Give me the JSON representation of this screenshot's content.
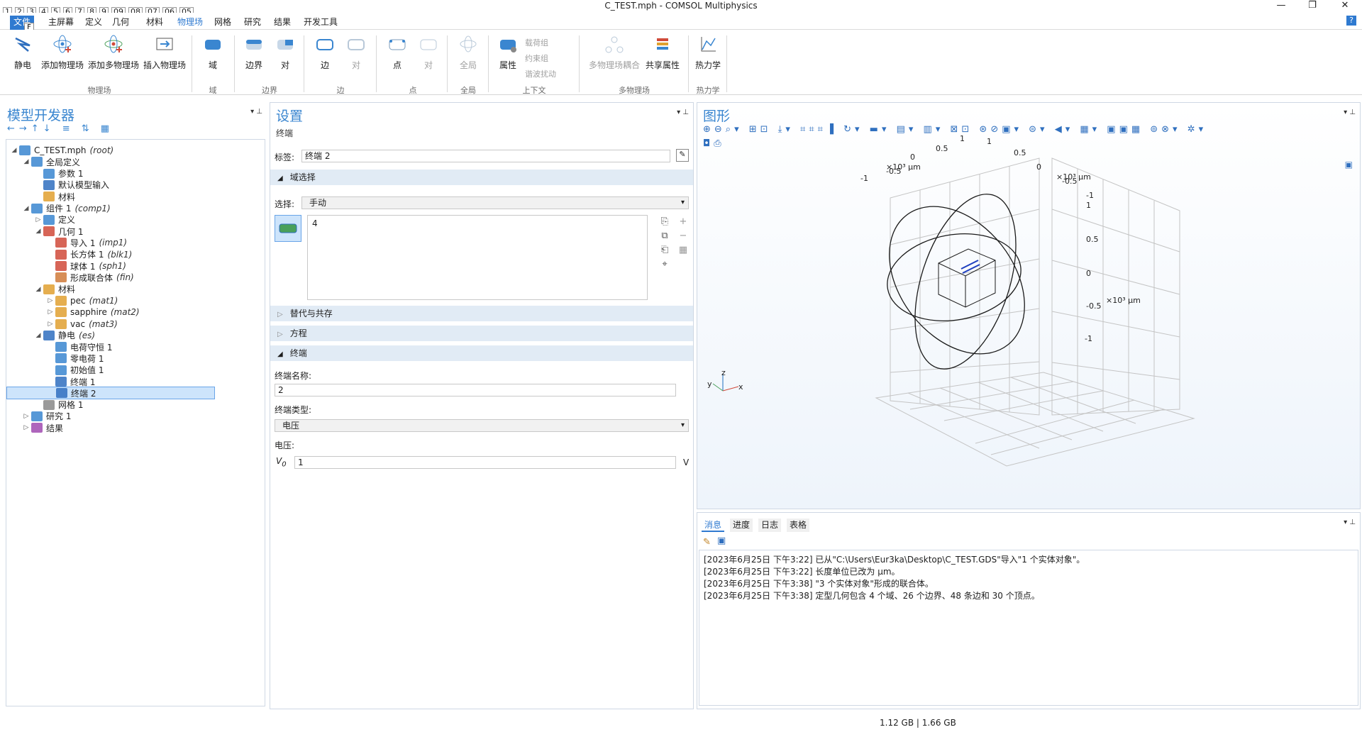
{
  "window": {
    "title": "C_TEST.mph - COMSOL Multiphysics",
    "min": "—",
    "max": "❐",
    "close": "✕"
  },
  "quick_access": {
    "keys": [
      "1",
      "2",
      "3",
      "4",
      "5",
      "6",
      "7",
      "8",
      "9",
      "09",
      "08",
      "07",
      "06",
      "05"
    ]
  },
  "menubar": {
    "file": "文件",
    "file_key": "F",
    "items": [
      "主屏幕",
      "定义",
      "几何",
      "材料",
      "物理场",
      "网格",
      "研究",
      "结果",
      "开发工具"
    ],
    "active": "物理场",
    "help": "?"
  },
  "ribbon": {
    "buttons": {
      "electrostatics": "静电",
      "add_physics": "添加物理场",
      "add_multiphysics": "添加多物理场",
      "insert_physics": "插入物理场",
      "domain": "域",
      "boundary": "边界",
      "pair": "对",
      "edge": "边",
      "edge_pair": "对",
      "point": "点",
      "point_pair": "对",
      "global": "全局",
      "attributes": "属性",
      "multiphysics_coupling": "多物理场耦合",
      "shared_properties": "共享属性",
      "thermodynamics": "热力学"
    },
    "small": {
      "load_group": "载荷组",
      "constraint_group": "约束组",
      "harmonic_perturbation": "谐波扰动"
    },
    "groups": {
      "physics": "物理场",
      "domain": "域",
      "boundary": "边界",
      "edge": "边",
      "point": "点",
      "global": "全局",
      "context": "上下文",
      "multiphysics": "多物理场",
      "thermo": "热力学"
    }
  },
  "model_builder": {
    "title": "模型开发器",
    "tree": [
      {
        "label": "C_TEST.mph",
        "tag": "(root)",
        "level": 0,
        "icon": "root-icon",
        "toggle": "◢"
      },
      {
        "label": "全局定义",
        "tag": "",
        "level": 1,
        "icon": "globe-icon",
        "toggle": "◢"
      },
      {
        "label": "参数 1",
        "tag": "",
        "level": 2,
        "icon": "parameters-icon",
        "toggle": ""
      },
      {
        "label": "默认模型输入",
        "tag": "",
        "level": 2,
        "icon": "model-input-icon",
        "toggle": ""
      },
      {
        "label": "材料",
        "tag": "",
        "level": 2,
        "icon": "materials-icon",
        "toggle": ""
      },
      {
        "label": "组件 1",
        "tag": "(comp1)",
        "level": 1,
        "icon": "component-icon",
        "toggle": "◢"
      },
      {
        "label": "定义",
        "tag": "",
        "level": 2,
        "icon": "definitions-icon",
        "toggle": "▷"
      },
      {
        "label": "几何 1",
        "tag": "",
        "level": 2,
        "icon": "geometry-icon",
        "toggle": "◢"
      },
      {
        "label": "导入 1",
        "tag": "(imp1)",
        "level": 3,
        "icon": "import-icon",
        "toggle": ""
      },
      {
        "label": "长方体 1",
        "tag": "(blk1)",
        "level": 3,
        "icon": "block-icon",
        "toggle": ""
      },
      {
        "label": "球体 1",
        "tag": "(sph1)",
        "level": 3,
        "icon": "sphere-icon",
        "toggle": ""
      },
      {
        "label": "形成联合体",
        "tag": "(fin)",
        "level": 3,
        "icon": "union-icon",
        "toggle": ""
      },
      {
        "label": "材料",
        "tag": "",
        "level": 2,
        "icon": "materials-icon",
        "toggle": "◢"
      },
      {
        "label": "pec",
        "tag": "(mat1)",
        "level": 3,
        "icon": "material-icon",
        "toggle": "▷"
      },
      {
        "label": "sapphire",
        "tag": "(mat2)",
        "level": 3,
        "icon": "material-icon",
        "toggle": "▷"
      },
      {
        "label": "vac",
        "tag": "(mat3)",
        "level": 3,
        "icon": "material-icon",
        "toggle": "▷"
      },
      {
        "label": "静电",
        "tag": "(es)",
        "level": 2,
        "icon": "electrostatics-icon",
        "toggle": "◢"
      },
      {
        "label": "电荷守恒 1",
        "tag": "",
        "level": 3,
        "icon": "charge-conservation-icon",
        "toggle": ""
      },
      {
        "label": "零电荷 1",
        "tag": "",
        "level": 3,
        "icon": "zero-charge-icon",
        "toggle": ""
      },
      {
        "label": "初始值 1",
        "tag": "",
        "level": 3,
        "icon": "initial-values-icon",
        "toggle": ""
      },
      {
        "label": "终端 1",
        "tag": "",
        "level": 3,
        "icon": "terminal-icon",
        "toggle": ""
      },
      {
        "label": "终端 2",
        "tag": "",
        "level": 3,
        "icon": "terminal-icon",
        "toggle": "",
        "selected": true
      },
      {
        "label": "网格 1",
        "tag": "",
        "level": 2,
        "icon": "mesh-icon",
        "toggle": ""
      },
      {
        "label": "研究 1",
        "tag": "",
        "level": 1,
        "icon": "study-icon",
        "toggle": "▷"
      },
      {
        "label": "结果",
        "tag": "",
        "level": 1,
        "icon": "results-icon",
        "toggle": "▷"
      }
    ]
  },
  "settings": {
    "title": "设置",
    "subtitle": "终端",
    "label_caption": "标签:",
    "label_value": "终端 2",
    "domain_selection": "域选择",
    "selection_caption": "选择:",
    "selection_value": "手动",
    "selection_list": "4",
    "sections": {
      "override": "替代与共存",
      "equation": "方程",
      "terminal": "终端"
    },
    "terminal_name_caption": "终端名称:",
    "terminal_name": "2",
    "terminal_type_caption": "终端类型:",
    "terminal_type": "电压",
    "voltage_caption": "电压:",
    "v0_label": "V",
    "v0_sub": "0",
    "v0_value": "1",
    "v0_unit": "V"
  },
  "graphics": {
    "title": "图形",
    "axis_labels": {
      "scale_left": "×10³ μm",
      "scale_right": "×10³ μm",
      "scale_z": "×10³ μm",
      "ticks_left": [
        "-1",
        "-0.5",
        "0",
        "0.5",
        "1"
      ],
      "ticks_right": [
        "1",
        "0.5",
        "0",
        "-0.5",
        "-1"
      ],
      "ticks_z": [
        "1",
        "0.5",
        "0",
        "-0.5",
        "-1"
      ],
      "triad": [
        "z",
        "y",
        "x"
      ]
    }
  },
  "messages": {
    "tabs": [
      "消息",
      "进度",
      "日志",
      "表格"
    ],
    "lines": [
      "[2023年6月25日 下午3:22] 已从\"C:\\Users\\Eur3ka\\Desktop\\C_TEST.GDS\"导入\"1 个实体对象\"。",
      "[2023年6月25日 下午3:22] 长度单位已改为 μm。",
      "[2023年6月25日 下午3:38] \"3 个实体对象\"形成的联合体。",
      "[2023年6月25日 下午3:38] 定型几何包含 4 个域、26 个边界、48 条边和 30 个顶点。"
    ]
  },
  "status": {
    "memory": "1.12 GB | 1.66 GB"
  },
  "colors": {
    "accent": "#3a86d0",
    "file_tab": "#2f7ad0",
    "section": "#e1ebf5",
    "selected": "#cde4fb"
  }
}
